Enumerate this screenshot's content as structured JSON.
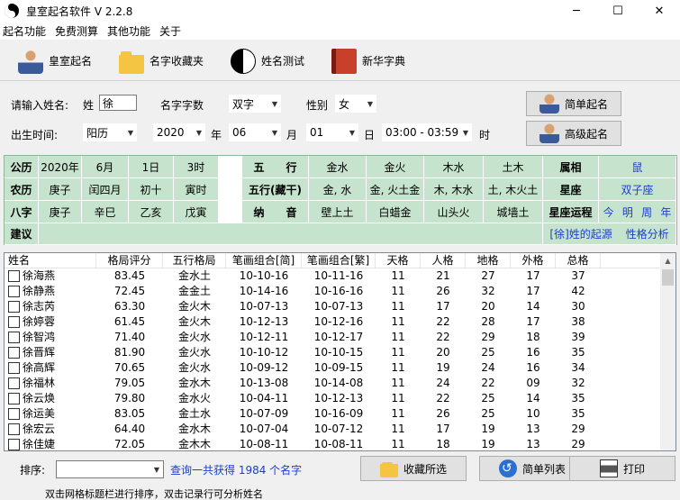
{
  "window": {
    "title": "皇室起名软件 V 2.2.8",
    "minimize": "─",
    "maximize": "☐",
    "close": "✕"
  },
  "menu": [
    "起名功能",
    "免费测算",
    "其他功能",
    "关于"
  ],
  "toolbar": [
    {
      "label": "皇室起名",
      "icon": "person-icon"
    },
    {
      "label": "名字收藏夹",
      "icon": "folder-icon"
    },
    {
      "label": "姓名测试",
      "icon": "taiji-icon"
    },
    {
      "label": "新华字典",
      "icon": "book-icon"
    }
  ],
  "form": {
    "prompt": "请输入姓名:",
    "surname_label": "姓",
    "surname": "徐",
    "count_label": "名字字数",
    "count": "双字",
    "gender_label": "性别",
    "gender": "女",
    "birth_label": "出生时间:",
    "calendar": "阳历",
    "year": "2020",
    "year_unit": "年",
    "month": "06",
    "month_unit": "月",
    "day": "01",
    "day_unit": "日",
    "hour": "03:00 - 03:59",
    "hour_unit": "时",
    "simple_btn": "简单起名",
    "advanced_btn": "高级起名"
  },
  "info": {
    "r1": [
      "公历",
      "2020年",
      "6月",
      "1日",
      "3时"
    ],
    "r2": [
      "农历",
      "庚子",
      "闰四月",
      "初十",
      "寅时"
    ],
    "r3": [
      "八字",
      "庚子",
      "辛巳",
      "乙亥",
      "戊寅"
    ],
    "wuxing_label": "五　　行",
    "wuxing": [
      "金水",
      "金火",
      "木水",
      "土木"
    ],
    "wuxing2_label": "五行(藏干)",
    "wuxing2": [
      "金, 水",
      "金, 火土金",
      "木, 木水",
      "土, 木火土"
    ],
    "nayin_label": "纳　　音",
    "nayin": [
      "壁上土",
      "白蜡金",
      "山头火",
      "城墙土"
    ],
    "zodiac_label": "属相",
    "zodiac": "鼠",
    "constellation_label": "星座",
    "constellation": "双子座",
    "fortune_label": "星座运程",
    "fortune": [
      "今",
      "明",
      "周",
      "年"
    ],
    "advice_label": "建议",
    "advice_link1": "[徐]姓的起源",
    "advice_link2": "性格分析"
  },
  "table": {
    "headers": [
      "姓名",
      "格局评分",
      "五行格局",
      "笔画组合[简]",
      "笔画组合[繁]",
      "天格",
      "人格",
      "地格",
      "外格",
      "总格"
    ],
    "rows": [
      [
        "徐海燕",
        "83.45",
        "金水土",
        "10-10-16",
        "10-11-16",
        "11",
        "21",
        "27",
        "17",
        "37"
      ],
      [
        "徐静燕",
        "72.45",
        "金金土",
        "10-14-16",
        "10-16-16",
        "11",
        "26",
        "32",
        "17",
        "42"
      ],
      [
        "徐志芮",
        "63.30",
        "金火木",
        "10-07-13",
        "10-07-13",
        "11",
        "17",
        "20",
        "14",
        "30"
      ],
      [
        "徐婷蓉",
        "61.45",
        "金火木",
        "10-12-13",
        "10-12-16",
        "11",
        "22",
        "28",
        "17",
        "38"
      ],
      [
        "徐智鸿",
        "71.40",
        "金火水",
        "10-12-11",
        "10-12-17",
        "11",
        "22",
        "29",
        "18",
        "39"
      ],
      [
        "徐晋辉",
        "81.90",
        "金火水",
        "10-10-12",
        "10-10-15",
        "11",
        "20",
        "25",
        "16",
        "35"
      ],
      [
        "徐高辉",
        "70.65",
        "金火水",
        "10-09-12",
        "10-09-15",
        "11",
        "19",
        "24",
        "16",
        "34"
      ],
      [
        "徐福林",
        "79.05",
        "金水木",
        "10-13-08",
        "10-14-08",
        "11",
        "24",
        "22",
        "09",
        "32"
      ],
      [
        "徐云焕",
        "79.80",
        "金水火",
        "10-04-11",
        "10-12-13",
        "11",
        "22",
        "25",
        "14",
        "35"
      ],
      [
        "徐运美",
        "83.05",
        "金土水",
        "10-07-09",
        "10-16-09",
        "11",
        "26",
        "25",
        "10",
        "35"
      ],
      [
        "徐宏云",
        "64.40",
        "金水木",
        "10-07-04",
        "10-07-12",
        "11",
        "17",
        "19",
        "13",
        "29"
      ],
      [
        "徐佳婕",
        "72.05",
        "金木木",
        "10-08-11",
        "10-08-11",
        "11",
        "18",
        "19",
        "13",
        "29"
      ]
    ]
  },
  "bottom": {
    "sort_label": "排序:",
    "result": "查询一共获得 1984 个名字",
    "collect_btn": "收藏所选",
    "simple_list_btn": "简单列表",
    "print_btn": "打印"
  },
  "status": "双击网格标题栏进行排序，双击记录行可分析姓名"
}
